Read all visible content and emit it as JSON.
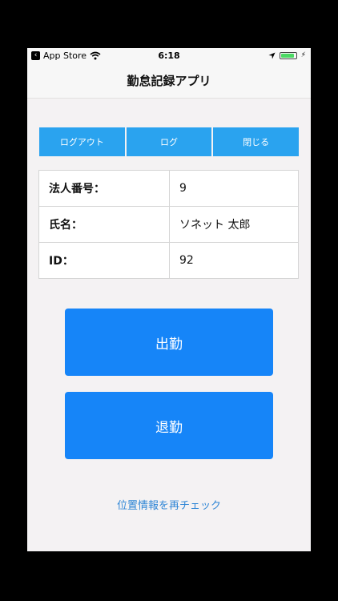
{
  "status_bar": {
    "back_label": "App Store",
    "time": "6:18"
  },
  "nav": {
    "title": "勤怠記録アプリ"
  },
  "toolbar": {
    "logout_label": "ログアウト",
    "log_label": "ログ",
    "close_label": "閉じる"
  },
  "info": {
    "rows": [
      {
        "label": "法人番号：",
        "value": "9"
      },
      {
        "label": "氏名：",
        "value": "ソネット 太郎"
      },
      {
        "label": "ID：",
        "value": "92"
      }
    ]
  },
  "actions": {
    "clock_in_label": "出勤",
    "clock_out_label": "退勤"
  },
  "recheck": {
    "label": "位置情報を再チェック"
  },
  "colors": {
    "toolbar_blue": "#2aa3ef",
    "action_blue": "#1685f8",
    "link_blue": "#2f86d6",
    "battery_green": "#4cd964"
  },
  "battery_level": 0.9
}
